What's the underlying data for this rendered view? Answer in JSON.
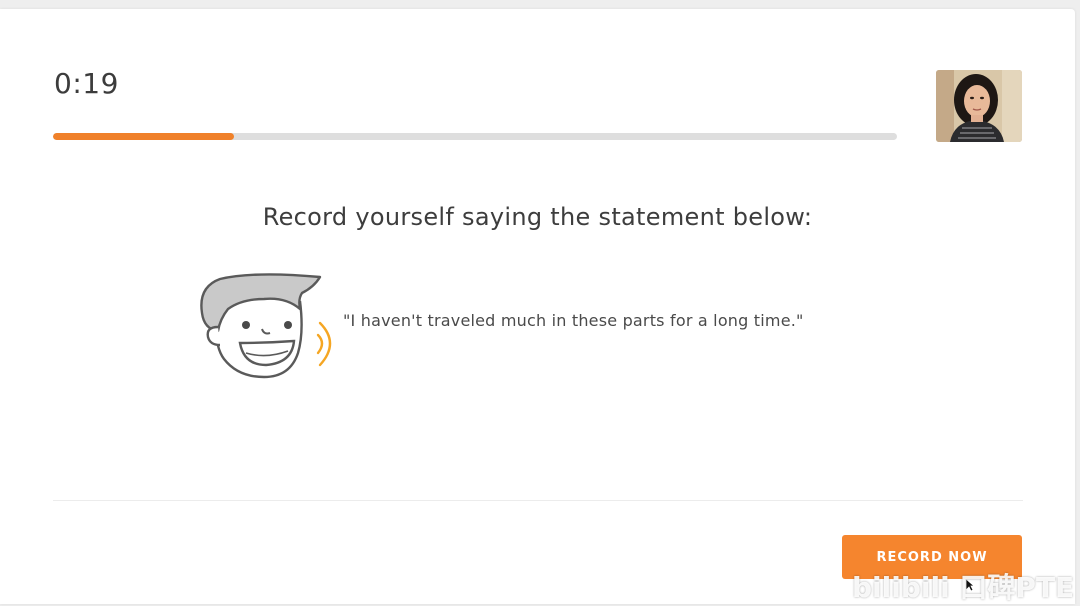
{
  "timer": {
    "elapsed": "0:19"
  },
  "progress": {
    "fraction": 0.215,
    "fill_color": "#f0812a",
    "track_color": "#dedede"
  },
  "webcam": {
    "icon": "webcam-preview"
  },
  "prompt": {
    "title": "Record yourself saying the statement below:",
    "statement": "\"I haven't traveled much in these parts for a long time.\""
  },
  "speaker": {
    "icon": "speaking-face-icon",
    "accent_color": "#f5a623"
  },
  "actions": {
    "record_label": "RECORD NOW",
    "record_color": "#f5852e"
  },
  "watermark": {
    "text": "bilibili 口碑PTE"
  }
}
